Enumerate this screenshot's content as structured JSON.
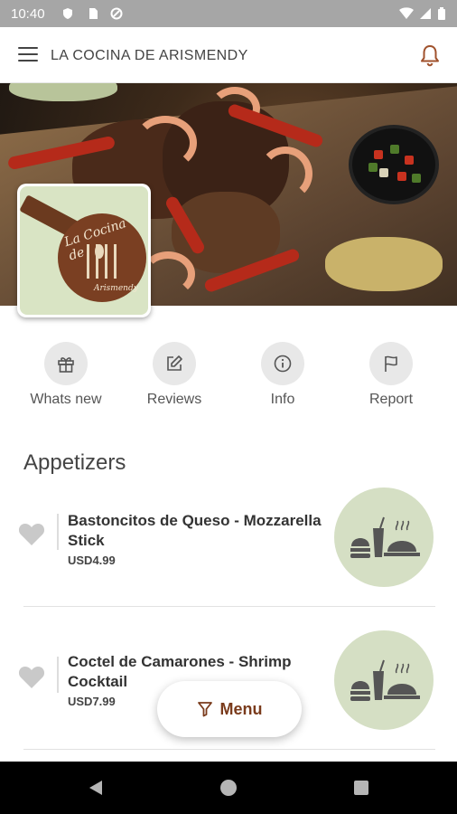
{
  "status_bar": {
    "time": "10:40"
  },
  "app_bar": {
    "title": "LA COCINA DE ARISMENDY"
  },
  "logo": {
    "text_top": "La Cocina de",
    "text_bottom": "Arismendy"
  },
  "actions": [
    {
      "label": "Whats new",
      "icon": "gift-icon"
    },
    {
      "label": "Reviews",
      "icon": "edit-icon"
    },
    {
      "label": "Info",
      "icon": "info-icon"
    },
    {
      "label": "Report",
      "icon": "flag-icon"
    }
  ],
  "section": {
    "title": "Appetizers"
  },
  "items": [
    {
      "name": "Bastoncitos de Queso - Mozzarella Stick",
      "price": "USD4.99",
      "image": "food-placeholder-icon"
    },
    {
      "name": "Coctel de Camarones - Shrimp Cocktail",
      "price": "USD7.99",
      "image": "food-placeholder-icon"
    }
  ],
  "menu_button": {
    "label": "Menu"
  },
  "colors": {
    "accent": "#7a3b1c",
    "status_bar": "#a6a6a6",
    "dish_bg": "#d5dfc4",
    "bell": "#a0522d"
  }
}
